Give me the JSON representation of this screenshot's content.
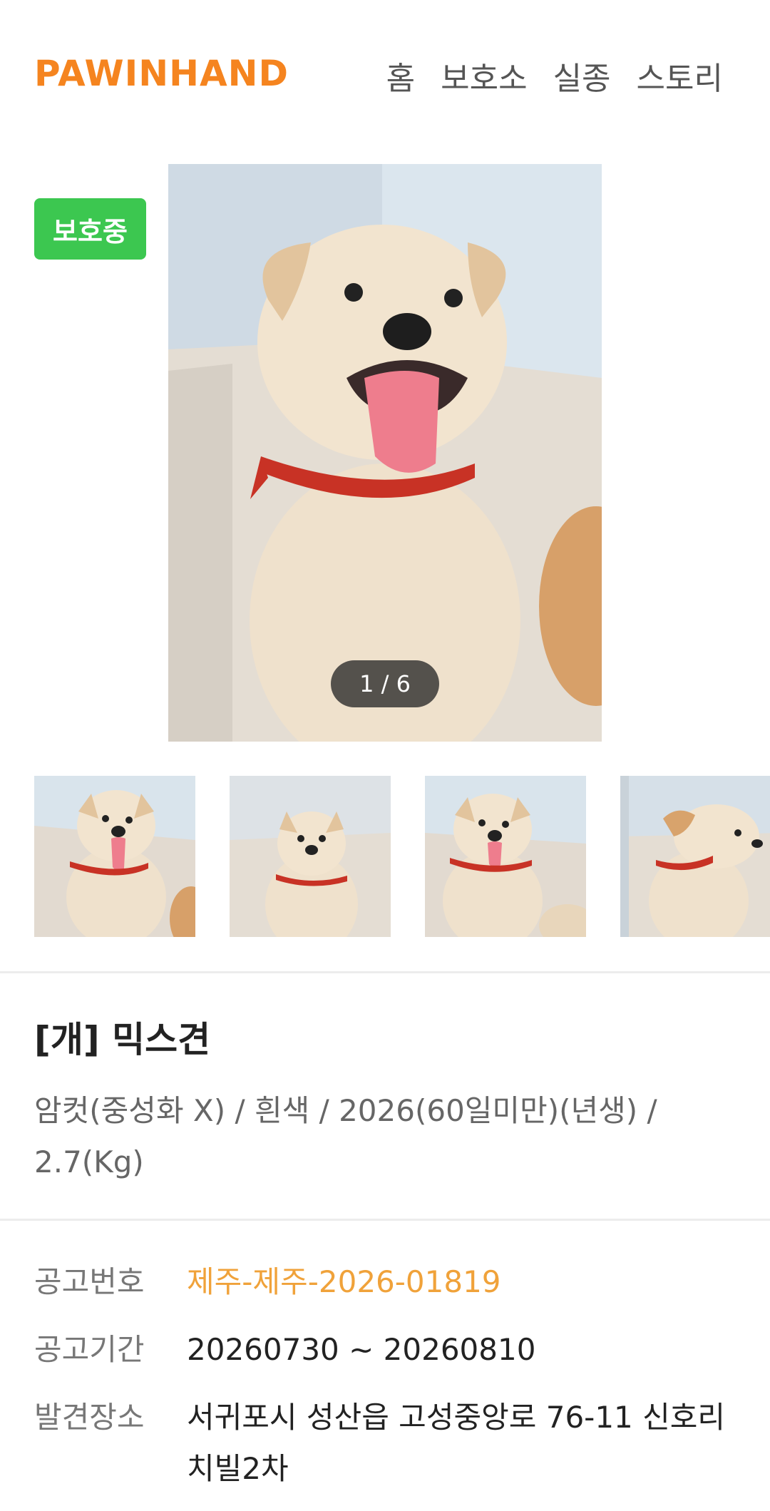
{
  "header": {
    "logo": "PAWINHAND",
    "nav": [
      "홈",
      "보호소",
      "실종",
      "스토리"
    ]
  },
  "status_badge": "보호중",
  "gallery": {
    "counter": "1 / 6"
  },
  "animal": {
    "title": "[개] 믹스견",
    "summary": "암컷(중성화 X) / 흰색 / 2026(60일미만)(년생) / 2.7(Kg)"
  },
  "details": [
    {
      "label": "공고번호",
      "value": "제주-제주-2026-01819"
    },
    {
      "label": "공고기간",
      "value": "20260730 ~ 20260810"
    },
    {
      "label": "발견장소",
      "value": "서귀포시 성산읍 고성중앙로 76-11 신호리치빌2차"
    }
  ],
  "colors": {
    "brand": "#f5841f",
    "badge": "#3cc750",
    "accent": "#f0a23a"
  }
}
